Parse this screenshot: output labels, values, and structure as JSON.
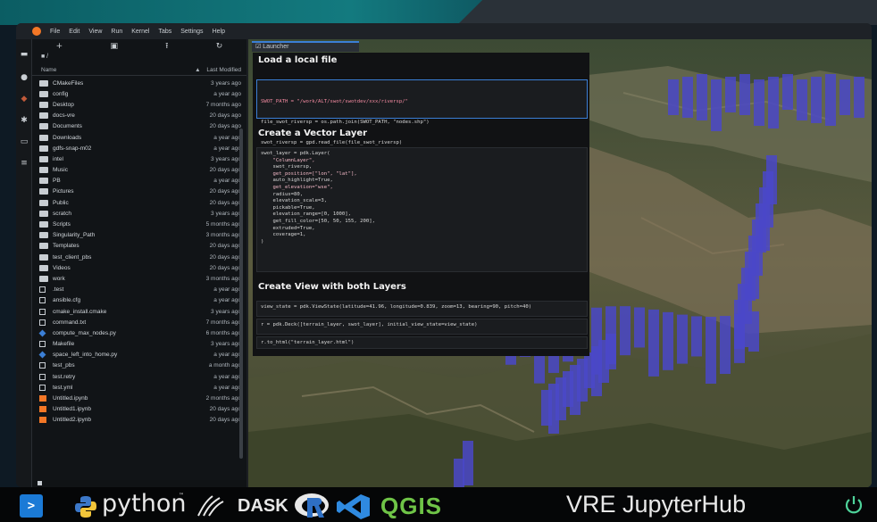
{
  "menu": {
    "items": [
      "File",
      "Edit",
      "View",
      "Run",
      "Kernel",
      "Tabs",
      "Settings",
      "Help"
    ]
  },
  "filebrowser": {
    "toolbar": [
      "+",
      "▣",
      "⭱",
      "↻"
    ],
    "path": "■ /",
    "column_name": "Name",
    "column_modified": "Last Modified",
    "sort_indicator": "▲",
    "files": [
      {
        "type": "folder",
        "name": "CMakeFiles",
        "modified": "3 years ago"
      },
      {
        "type": "folder",
        "name": "config",
        "modified": "a year ago"
      },
      {
        "type": "folder",
        "name": "Desktop",
        "modified": "7 months ago"
      },
      {
        "type": "folder",
        "name": "docs-vre",
        "modified": "20 days ago"
      },
      {
        "type": "folder",
        "name": "Documents",
        "modified": "20 days ago"
      },
      {
        "type": "folder",
        "name": "Downloads",
        "modified": "a year ago"
      },
      {
        "type": "folder",
        "name": "gdfs-snap-m02",
        "modified": "a year ago"
      },
      {
        "type": "folder",
        "name": "intel",
        "modified": "3 years ago"
      },
      {
        "type": "folder",
        "name": "Music",
        "modified": "20 days ago"
      },
      {
        "type": "folder",
        "name": "PB",
        "modified": "a year ago"
      },
      {
        "type": "folder",
        "name": "Pictures",
        "modified": "20 days ago"
      },
      {
        "type": "folder",
        "name": "Public",
        "modified": "20 days ago"
      },
      {
        "type": "folder",
        "name": "scratch",
        "modified": "3 years ago"
      },
      {
        "type": "folder",
        "name": "Scripts",
        "modified": "5 months ago"
      },
      {
        "type": "folder",
        "name": "Singularity_Path",
        "modified": "3 months ago"
      },
      {
        "type": "folder",
        "name": "Templates",
        "modified": "20 days ago"
      },
      {
        "type": "folder",
        "name": "test_client_pbs",
        "modified": "20 days ago"
      },
      {
        "type": "folder",
        "name": "Videos",
        "modified": "20 days ago"
      },
      {
        "type": "folder",
        "name": "work",
        "modified": "3 months ago"
      },
      {
        "type": "file",
        "name": ".test",
        "modified": "a year ago"
      },
      {
        "type": "file",
        "name": "ansible.cfg",
        "modified": "a year ago"
      },
      {
        "type": "file",
        "name": "cmake_install.cmake",
        "modified": "3 years ago"
      },
      {
        "type": "file",
        "name": "command.txt",
        "modified": "7 months ago"
      },
      {
        "type": "py",
        "name": "compute_max_nodes.py",
        "modified": "6 months ago"
      },
      {
        "type": "file",
        "name": "Makefile",
        "modified": "3 years ago"
      },
      {
        "type": "py",
        "name": "space_left_into_home.py",
        "modified": "a year ago"
      },
      {
        "type": "file",
        "name": "test_pbs",
        "modified": "a month ago"
      },
      {
        "type": "file",
        "name": "test.retry",
        "modified": "a year ago"
      },
      {
        "type": "file",
        "name": "test.yml",
        "modified": "a year ago"
      },
      {
        "type": "nb",
        "name": "Untitled.ipynb",
        "modified": "2 months ago"
      },
      {
        "type": "nb",
        "name": "Untitled1.ipynb",
        "modified": "20 days ago"
      },
      {
        "type": "nb",
        "name": "Untitled2.ipynb",
        "modified": "20 days ago"
      }
    ]
  },
  "tab": {
    "label": "Launcher"
  },
  "notebook": {
    "h1": "Load a local file",
    "cell1": [
      "SWOT_PATH = \"/work/ALT/swot/swotdev/xxx/riversp/\"",
      "file_swot_riversp = os.path.join(SWOT_PATH, \"nodes.shp\")",
      "swot_riversp = gpd.read_file(file_swot_riversp)"
    ],
    "h2": "Create a Vector Layer",
    "cell2": [
      "swot_layer = pdk.Layer(",
      "    \"ColumnLayer\",",
      "    swot_riversp,",
      "    get_position=[\"lon\", \"lat\"],",
      "    auto_highlight=True,",
      "    get_elevation=\"wse\",",
      "    radius=80,",
      "    elevation_scale=3,",
      "    pickable=True,",
      "    elevation_range=[0, 1000],",
      "    get_fill_color=[50, 50, 155, 200],",
      "    extruded=True,",
      "    coverage=1,",
      ")"
    ],
    "h3": "Create View with both Layers",
    "cell3": "view_state = pdk.ViewState(latitude=41.96, longitude=0.839, zoom=13, bearing=90, pitch=40)",
    "cell4": "r = pdk.Deck([terrain_layer, swot_layer], initial_view_state=view_state)",
    "cell5": "r.to_html(\"terrain_layer.html\")"
  },
  "bottombar": {
    "python": "python",
    "tm": "™",
    "dask": "DASK",
    "qgis": "QGIS",
    "hub": "VRE JupyterHub"
  },
  "colors": {
    "accent": "#3b7fd6",
    "column": "#4a48c8",
    "qgis": "#6fc447",
    "jupyter": "#f37726"
  }
}
